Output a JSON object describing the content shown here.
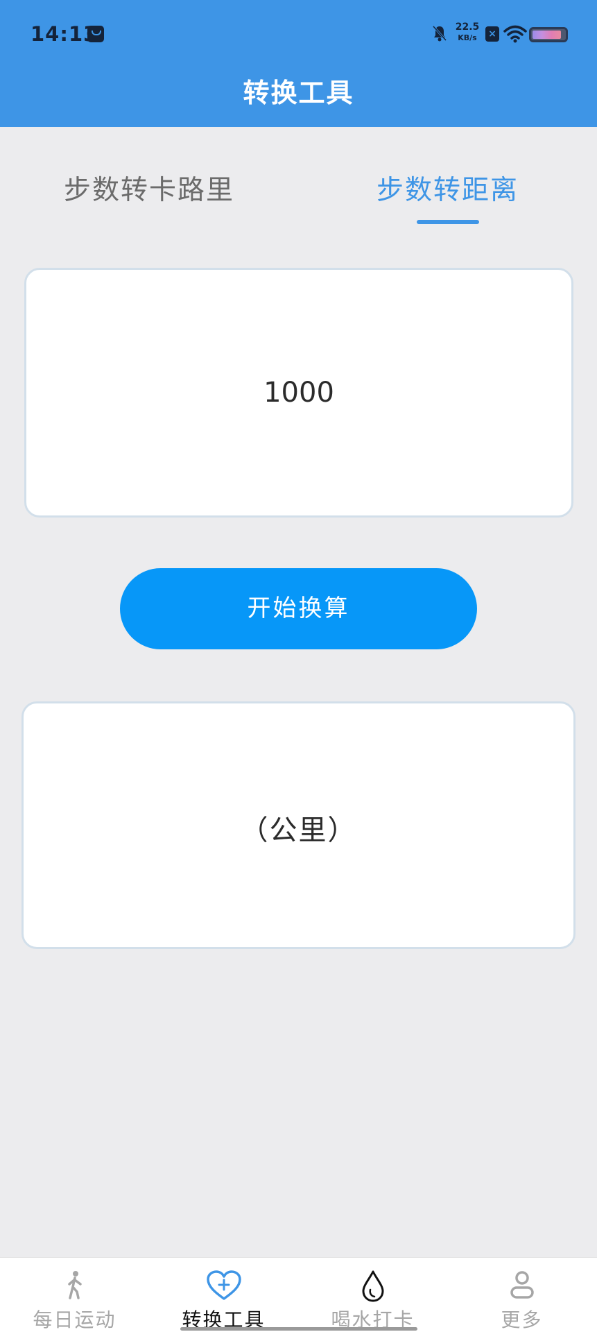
{
  "status_bar": {
    "time": "14:13",
    "net_speed": "22.5",
    "net_speed_unit": "KB/s",
    "battery_level": 0.85
  },
  "header": {
    "title": "转换工具"
  },
  "tabs": [
    {
      "label": "步数转卡路里",
      "active": false
    },
    {
      "label": "步数转距离",
      "active": true
    }
  ],
  "input": {
    "value": "1000"
  },
  "convert_button": {
    "label": "开始换算"
  },
  "result": {
    "text": "（公里）"
  },
  "bottom_nav": [
    {
      "label": "每日运动",
      "icon": "walking-person-icon",
      "active": false
    },
    {
      "label": "转换工具",
      "icon": "heart-plus-icon",
      "active": true
    },
    {
      "label": "喝水打卡",
      "icon": "water-drop-icon",
      "active": false
    },
    {
      "label": "更多",
      "icon": "person-icon",
      "active": false
    }
  ],
  "colors": {
    "primary": "#3E95E6",
    "button": "#0797F8",
    "background": "#ECECEE",
    "inactive_text": "#6B6B6B"
  }
}
